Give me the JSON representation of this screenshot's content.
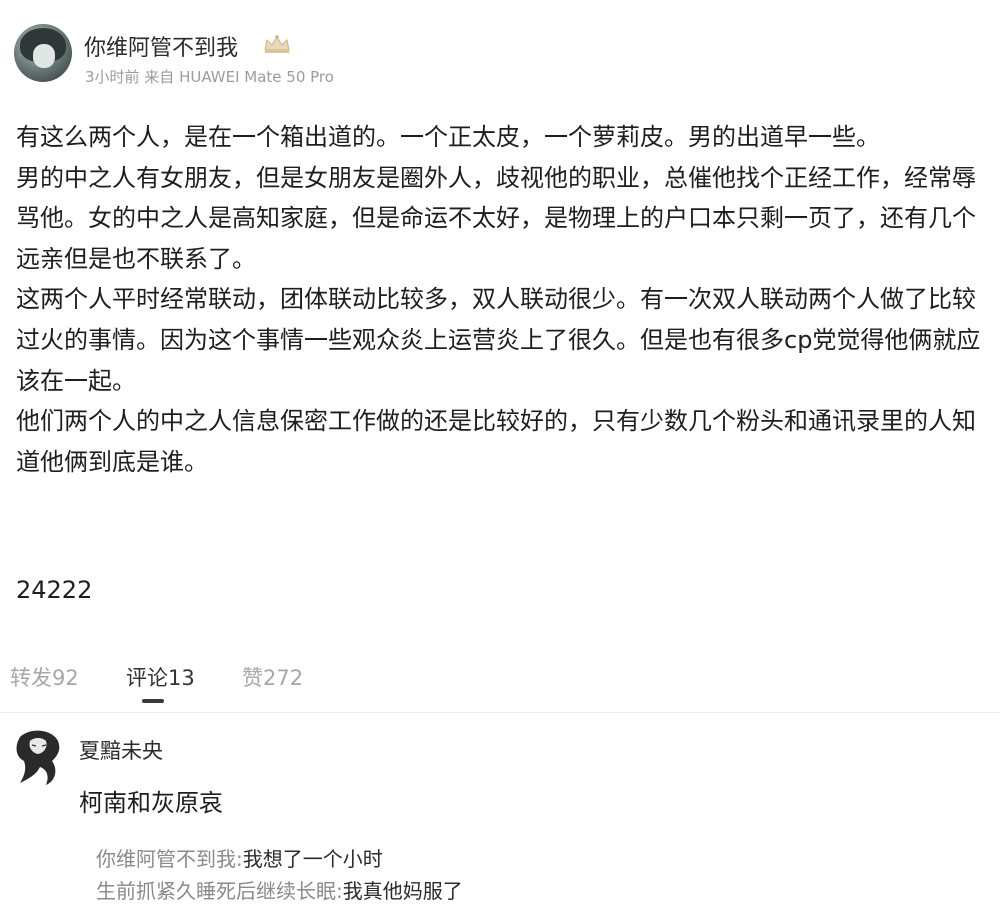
{
  "post": {
    "author": {
      "name": "你维阿管不到我",
      "badge_icon": "crown-icon"
    },
    "meta": "3小时前 来自 HUAWEI Mate 50 Pro",
    "paragraphs": [
      "有这么两个人，是在一个箱出道的。一个正太皮，一个萝莉皮。男的出道早一些。",
      "男的中之人有女朋友，但是女朋友是圈外人，歧视他的职业，总催他找个正经工作，经常辱骂他。女的中之人是高知家庭，但是命运不太好，是物理上的户口本只剩一页了，还有几个远亲但是也不联系了。",
      "这两个人平时经常联动，团体联动比较多，双人联动很少。有一次双人联动两个人做了比较过火的事情。因为这个事情一些观众炎上运营炎上了很久。但是也有很多cp党觉得他俩就应该在一起。",
      "他们两个人的中之人信息保密工作做的还是比较好的，只有少数几个粉头和通讯录里的人知道他俩到底是谁。"
    ],
    "code": "24222"
  },
  "tabs": [
    {
      "label": "转发92",
      "active": false
    },
    {
      "label": "评论13",
      "active": true
    },
    {
      "label": "赞272",
      "active": false
    }
  ],
  "comment": {
    "author": "夏黯未央",
    "text": "柯南和灰原哀",
    "replies": [
      {
        "author": "你维阿管不到我",
        "separator": ":",
        "text": "我想了一个小时"
      },
      {
        "author": "生前抓紧久睡死后继续长眠",
        "separator": ":",
        "text": "我真他妈服了"
      }
    ]
  },
  "colors": {
    "text": "#1e1e1e",
    "muted": "#9c9c9c",
    "tab_inactive": "#a7a7a7",
    "tab_active": "#333333",
    "divider": "#ededed"
  }
}
